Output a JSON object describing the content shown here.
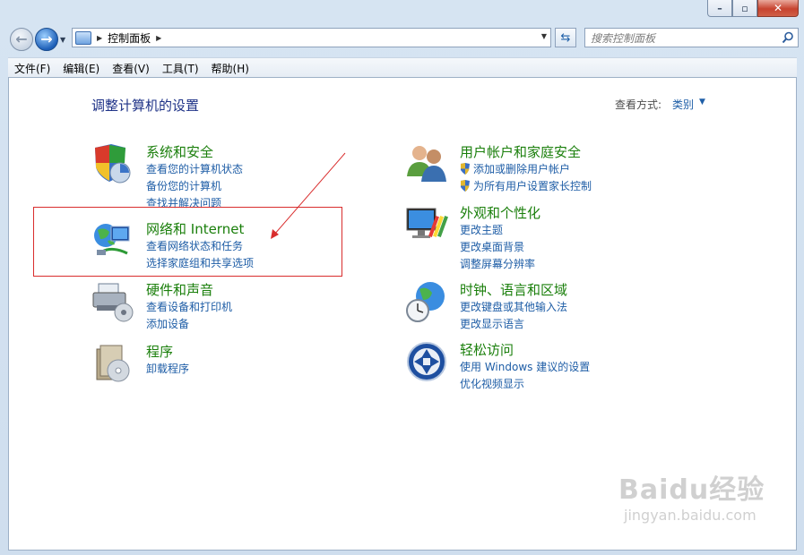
{
  "window": {
    "min_glyph": "–",
    "max_glyph": "▫",
    "close_glyph": "✕"
  },
  "nav": {
    "address_crumb": "控制面板",
    "search_placeholder": "搜索控制面板"
  },
  "menubar": {
    "items": [
      "文件(F)",
      "编辑(E)",
      "查看(V)",
      "工具(T)",
      "帮助(H)"
    ]
  },
  "main": {
    "title": "调整计算机的设置",
    "view_by_label": "查看方式:",
    "view_by_value": "类别",
    "categories": [
      {
        "icon": "system-security-icon",
        "title": "系统和安全",
        "links": [
          "查看您的计算机状态",
          "备份您的计算机",
          "查找并解决问题"
        ]
      },
      {
        "icon": "network-internet-icon",
        "title": "网络和 Internet",
        "links": [
          "查看网络状态和任务",
          "选择家庭组和共享选项"
        ]
      },
      {
        "icon": "hardware-sound-icon",
        "title": "硬件和声音",
        "links": [
          "查看设备和打印机",
          "添加设备"
        ]
      },
      {
        "icon": "programs-icon",
        "title": "程序",
        "links": [
          "卸载程序"
        ]
      },
      {
        "icon": "user-accounts-icon",
        "title": "用户帐户和家庭安全",
        "links": [
          "添加或删除用户帐户",
          "为所有用户设置家长控制"
        ]
      },
      {
        "icon": "appearance-icon",
        "title": "外观和个性化",
        "links": [
          "更改主题",
          "更改桌面背景",
          "调整屏幕分辨率"
        ]
      },
      {
        "icon": "clock-language-icon",
        "title": "时钟、语言和区域",
        "links": [
          "更改键盘或其他输入法",
          "更改显示语言"
        ]
      },
      {
        "icon": "ease-of-access-icon",
        "title": "轻松访问",
        "links": [
          "使用 Windows 建议的设置",
          "优化视频显示"
        ]
      }
    ]
  },
  "watermark": {
    "main": "Baidu经验",
    "sub": "jingyan.baidu.com"
  },
  "colors": {
    "title_green": "#1a7f0b",
    "link_blue": "#1e5da6",
    "annotation_red": "#d92d2d"
  }
}
